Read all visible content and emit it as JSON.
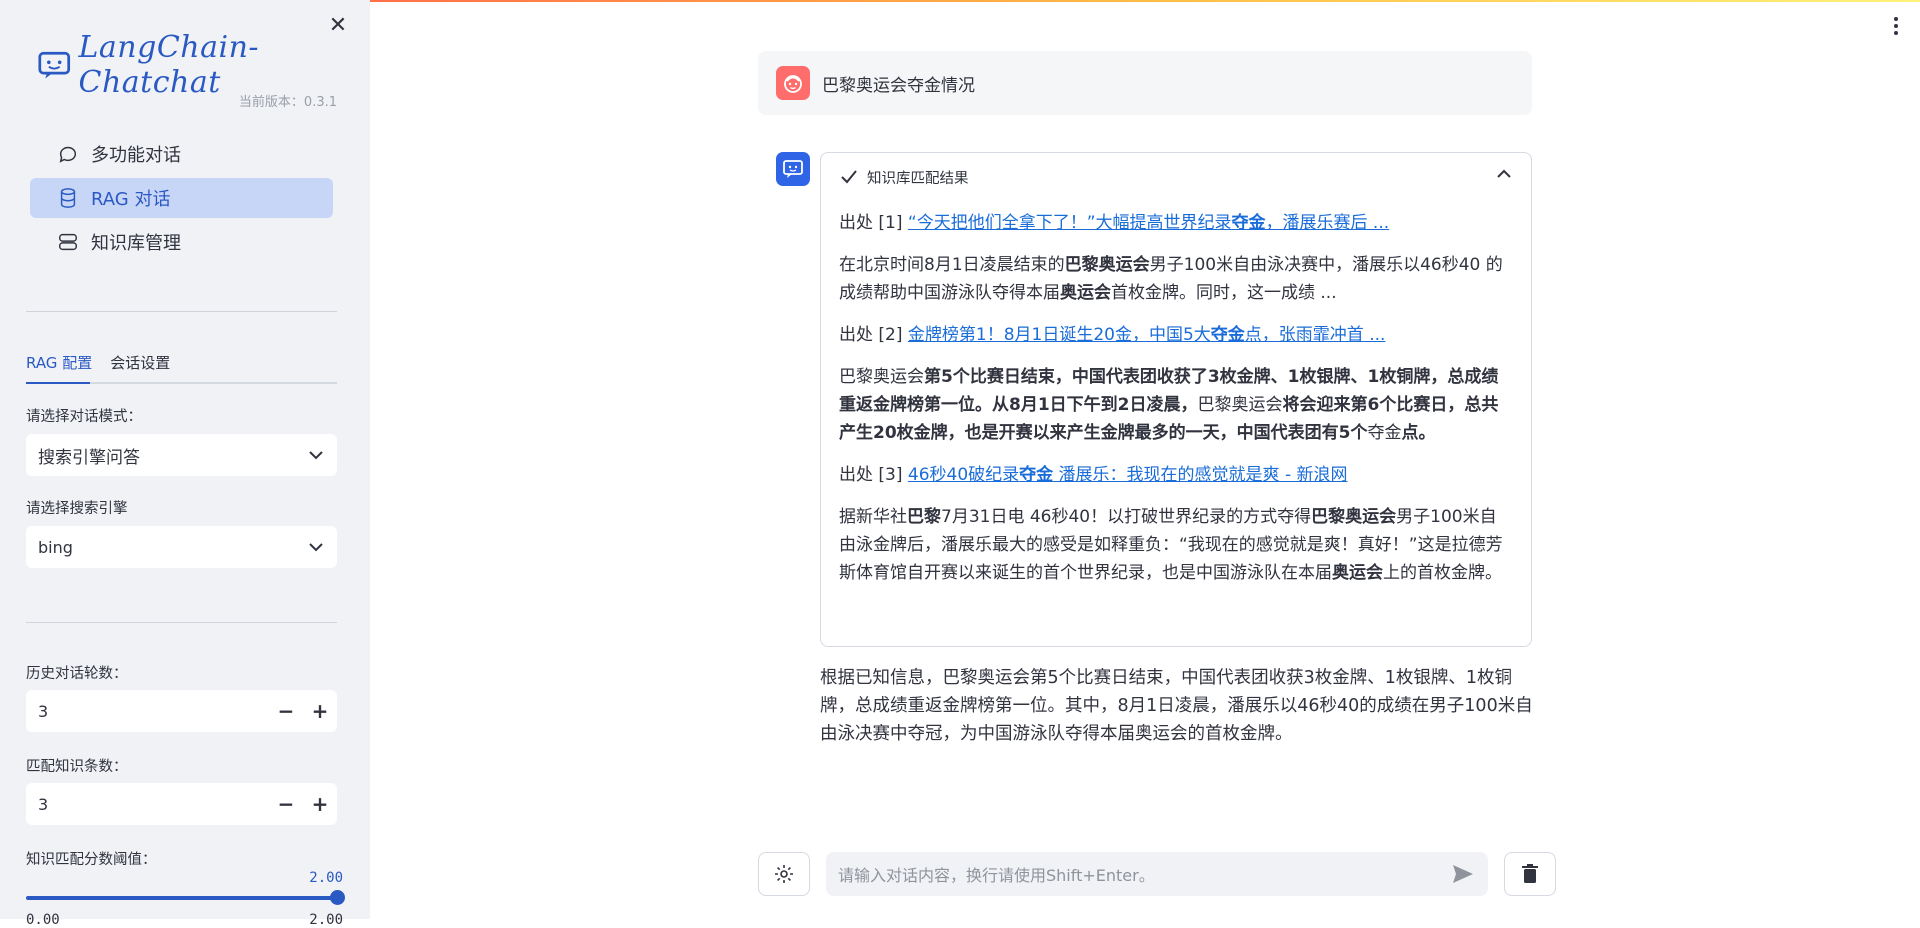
{
  "app": {
    "logo_text": "LangChain-Chatchat",
    "version_label": "当前版本：0.3.1",
    "close_glyph": "✕"
  },
  "sidebar": {
    "menu": [
      {
        "label": "多功能对话",
        "icon": "chat-bubble-icon"
      },
      {
        "label": "RAG 对话",
        "icon": "database-icon",
        "active": true
      },
      {
        "label": "知识库管理",
        "icon": "server-icon"
      }
    ],
    "tabs": [
      {
        "label": "RAG 配置",
        "active": true
      },
      {
        "label": "会话设置"
      }
    ],
    "dialog_mode_label": "请选择对话模式：",
    "dialog_mode_value": "搜索引擎问答",
    "search_engine_label": "请选择搜索引擎",
    "search_engine_value": "bing",
    "history_label": "历史对话轮数：",
    "history_value": "3",
    "match_count_label": "匹配知识条数：",
    "match_count_value": "3",
    "threshold_label": "知识匹配分数阈值：",
    "threshold_value": "2.00",
    "threshold_min": "0.00",
    "threshold_max": "2.00",
    "minus": "−",
    "plus": "+"
  },
  "chat": {
    "user_message": "巴黎奥运会夺金情况",
    "expander_title": "知识库匹配结果",
    "sources": [
      {
        "prefix": "出处 [1] ",
        "link_parts": [
          "“今天把他们全拿下了！”大幅提高世界纪录",
          "夺金",
          "，潘展乐赛后 ..."
        ],
        "text_parts": [
          "在北京时间8月1日凌晨结束的",
          "巴黎奥运会",
          "男子100米自由泳决赛中，潘展乐以46秒40 的成绩帮助中国游泳队夺得本届",
          "奥运会",
          "首枚金牌。同时，这一成绩 ..."
        ]
      },
      {
        "prefix": "出处 [2] ",
        "link_parts": [
          "金牌榜第1！8月1日诞生20金，中国5大",
          "夺金",
          "点，张雨霏冲首 ..."
        ],
        "text_parts": [
          "巴黎奥运会",
          "第5个比赛日结束，中国代表团收获了3枚金牌、1枚银牌、1枚铜牌，总成绩重返金牌榜第一位。从8月1日下午到2日凌晨，",
          "巴黎奥运会",
          "将会迎来第6个比赛日，总共产生20枚金牌，也是开赛以来产生金牌最多的一天，中国代表团有5个",
          "夺金",
          "点。"
        ]
      },
      {
        "prefix": "出处 [3] ",
        "link_parts": [
          "46秒40破纪录",
          "夺金",
          " 潘展乐：我现在的感觉就是爽 - 新浪网"
        ],
        "text_parts": [
          "据新华社",
          "巴黎",
          "7月31日电 46秒40！以打破世界纪录的方式夺得",
          "巴黎奥运会",
          "男子100米自由泳金牌后，潘展乐最大的感受是如释重负：“我现在的感觉就是爽！真好！”这是拉德芳斯体育馆自开赛以来诞生的首个世界纪录，也是中国游泳队在本届",
          "奥运会",
          "上的首枚金牌。"
        ]
      }
    ],
    "answer": "根据已知信息，巴黎奥运会第5个比赛日结束，中国代表团收获3枚金牌、1枚银牌、1枚铜牌，总成绩重返金牌榜第一位。其中，8月1日凌晨，潘展乐以46秒40的成绩在男子100米自由泳决赛中夺冠，为中国游泳队夺得本届奥运会的首枚金牌。",
    "input_placeholder": "请输入对话内容，换行请使用Shift+Enter。"
  },
  "colors": {
    "accent": "#2b59c3",
    "user_avatar": "#ff6c6c",
    "bot_avatar": "#2f64e6",
    "link": "#1a6dd8"
  }
}
